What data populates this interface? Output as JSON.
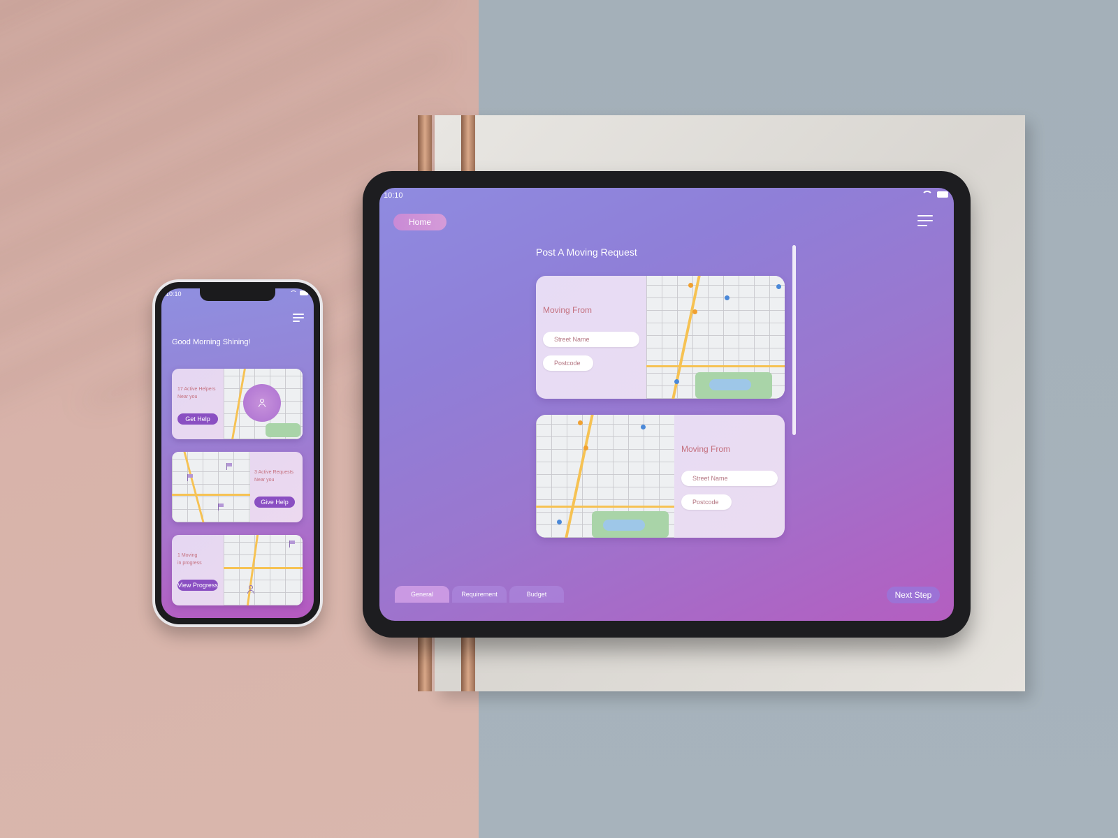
{
  "tablet": {
    "status_time": "10:10",
    "home_label": "Home",
    "page_title": "Post A Moving Request",
    "cards": [
      {
        "label": "Moving From",
        "street_placeholder": "Street Name",
        "postcode_placeholder": "Postcode"
      },
      {
        "label": "Moving From",
        "street_placeholder": "Street Name",
        "postcode_placeholder": "Postcode"
      }
    ],
    "tabs": [
      "General",
      "Requirement",
      "Budget"
    ],
    "active_tab": "General",
    "next_button": "Next Step"
  },
  "phone": {
    "status_time": "10:10",
    "greeting": "Good Morning Shining!",
    "cards": [
      {
        "line1": "17 Active Helpers",
        "line2": "Near you",
        "button": "Get Help"
      },
      {
        "line1": "3 Active Requests",
        "line2": "Near you",
        "button": "Give Help"
      },
      {
        "line1": "1 Moving",
        "line2": "in progress",
        "button": "View Progress"
      }
    ]
  },
  "icons": [
    "menu-icon",
    "wifi-icon",
    "battery-icon",
    "person-icon",
    "flag-icon"
  ],
  "colors": {
    "accent_purple": "#8a4fc2",
    "label_rose": "#c4707e",
    "gradient_start": "#8f8be0",
    "gradient_end": "#b45ec0"
  }
}
